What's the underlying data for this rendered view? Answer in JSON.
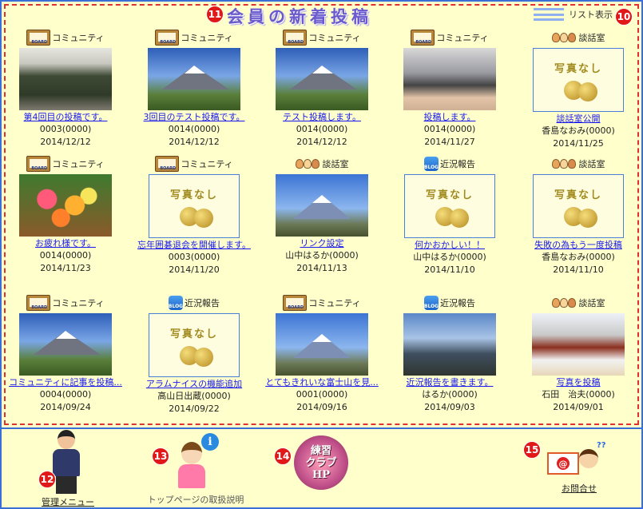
{
  "header": {
    "title": "会員の新着投稿",
    "title_number": "11",
    "list_view_label": "リスト表示",
    "list_view_number": "10"
  },
  "posts": [
    {
      "category": "コミュニティ",
      "category_icon": "board-icon",
      "thumb": "photo",
      "thumb_scene": "crowd",
      "title": "第4回目の投稿です。",
      "author": "",
      "count": "0003(0000)",
      "date": "2014/12/12"
    },
    {
      "category": "コミュニティ",
      "category_icon": "board-icon",
      "thumb": "photo",
      "thumb_scene": "mountain",
      "title": "3回目のテスト投稿です。",
      "author": "",
      "count": "0014(0000)",
      "date": "2014/12/12"
    },
    {
      "category": "コミュニティ",
      "category_icon": "board-icon",
      "thumb": "photo",
      "thumb_scene": "mountain",
      "title": "テスト投稿します。",
      "author": "",
      "count": "0014(0000)",
      "date": "2014/12/12"
    },
    {
      "category": "コミュニティ",
      "category_icon": "board-icon",
      "thumb": "photo",
      "thumb_scene": "hands",
      "title": "投稿します。",
      "author": "",
      "count": "0014(0000)",
      "date": "2014/11/27"
    },
    {
      "category": "談話室",
      "category_icon": "talk-icon",
      "thumb": "none",
      "thumb_scene": "",
      "title": "談話室公開",
      "author": "香島なおみ",
      "count": "(0000)",
      "date": "2014/11/25"
    },
    {
      "category": "コミュニティ",
      "category_icon": "board-icon",
      "thumb": "photo",
      "thumb_scene": "flowers",
      "title": "お疲れ様です。",
      "author": "",
      "count": "0014(0000)",
      "date": "2014/11/23"
    },
    {
      "category": "コミュニティ",
      "category_icon": "board-icon",
      "thumb": "none",
      "thumb_scene": "",
      "title": "忘年囲碁退会を開催します。",
      "author": "",
      "count": "0003(0000)",
      "date": "2014/11/20"
    },
    {
      "category": "談話室",
      "category_icon": "talk-icon",
      "thumb": "photo",
      "thumb_scene": "fuji",
      "title": "リンク設定",
      "author": "山中はるか",
      "count": "(0000)",
      "date": "2014/11/13"
    },
    {
      "category": "近況報告",
      "category_icon": "blog-icon",
      "thumb": "none",
      "thumb_scene": "",
      "title": "何かおかしい！！",
      "author": "山中はるか",
      "count": "(0000)",
      "date": "2014/11/10"
    },
    {
      "category": "談話室",
      "category_icon": "talk-icon",
      "thumb": "none",
      "thumb_scene": "",
      "title": "失敗の為もう一度投稿",
      "author": "香島なおみ",
      "count": "(0000)",
      "date": "2014/11/10"
    },
    {
      "category": "コミュニティ",
      "category_icon": "board-icon",
      "thumb": "photo",
      "thumb_scene": "mountain",
      "title": "コミュニティに記事を投稿...",
      "author": "",
      "count": "0004(0000)",
      "date": "2014/09/24"
    },
    {
      "category": "近況報告",
      "category_icon": "blog-icon",
      "thumb": "none",
      "thumb_scene": "",
      "title": "アラムナイスの機能追加",
      "author": "高山日出蔵",
      "count": "(0000)",
      "date": "2014/09/22"
    },
    {
      "category": "コミュニティ",
      "category_icon": "board-icon",
      "thumb": "photo",
      "thumb_scene": "fuji",
      "title": "とてもきれいな富士山を見...",
      "author": "",
      "count": "0001(0000)",
      "date": "2014/09/16"
    },
    {
      "category": "近況報告",
      "category_icon": "blog-icon",
      "thumb": "photo",
      "thumb_scene": "city",
      "title": "近況報告を書きます。",
      "author": "はるか",
      "count": "(0000)",
      "date": "2014/09/03"
    },
    {
      "category": "談話室",
      "category_icon": "talk-icon",
      "thumb": "photo",
      "thumb_scene": "shrine",
      "title": "写真を投稿",
      "author": "石田　治夫",
      "count": "(0000)",
      "date": "2014/09/01"
    }
  ],
  "no_photo_label": "写真なし",
  "footer": {
    "admin_menu_label": "管理メニュー",
    "admin_menu_number": "12",
    "guide_label": "トップページの取扱説明",
    "guide_number": "13",
    "practice_club_line1": "練習",
    "practice_club_line2": "クラブ",
    "practice_club_line3": "HP",
    "practice_club_number": "14",
    "contact_label": "お問合せ",
    "contact_number": "15"
  },
  "colors": {
    "background": "#ffffcc",
    "frame_blue": "#3a6fd8",
    "dashed_red": "#e03030",
    "link_blue": "#1a1aee",
    "title_purple": "#6a5acd"
  }
}
